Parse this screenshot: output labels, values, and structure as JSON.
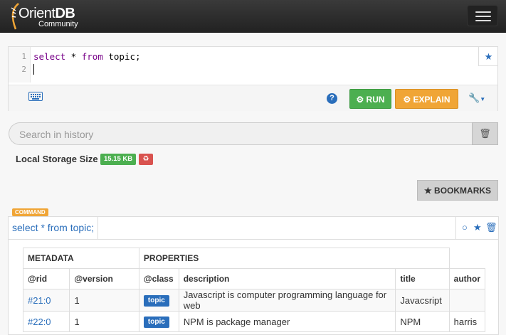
{
  "navbar": {
    "brand_main": "Orient",
    "brand_db": "DB",
    "brand_sub": "Community"
  },
  "editor": {
    "lines": [
      {
        "num": "1",
        "kw1": "select",
        "mid": " * ",
        "kw2": "from",
        "rest": " topic;"
      },
      {
        "num": "2"
      }
    ],
    "run_label": "RUN",
    "explain_label": "EXPLAIN",
    "help_label": "?"
  },
  "history": {
    "search_placeholder": "Search in history"
  },
  "storage": {
    "label": "Local Storage Size",
    "size": "15.15 KB"
  },
  "bookmarks_label": "BOOKMARKS",
  "command": {
    "tag": "COMMAND",
    "query": "select * from topic;"
  },
  "results": {
    "group_headers": [
      "METADATA",
      "PROPERTIES"
    ],
    "columns": [
      "@rid",
      "@version",
      "@class",
      "description",
      "title",
      "author"
    ],
    "rows": [
      {
        "rid": "#21:0",
        "version": "1",
        "class": "topic",
        "description": "Javascript is computer programming language for web",
        "title": "Javacsript",
        "author": ""
      },
      {
        "rid": "#22:0",
        "version": "1",
        "class": "topic",
        "description": "NPM is package manager",
        "title": "NPM",
        "author": "harris"
      }
    ]
  },
  "colors": {
    "accent": "#2a6ebb",
    "run": "#4caf50",
    "explain": "#f0a536",
    "danger": "#d9534f"
  },
  "icons": [
    "orientdb-logo-icon",
    "hamburger-icon",
    "star-icon",
    "keyboard-icon",
    "help-icon",
    "cog-icon",
    "cogs-icon",
    "wrench-icon",
    "trash-icon",
    "recycle-icon",
    "circle-icon"
  ]
}
